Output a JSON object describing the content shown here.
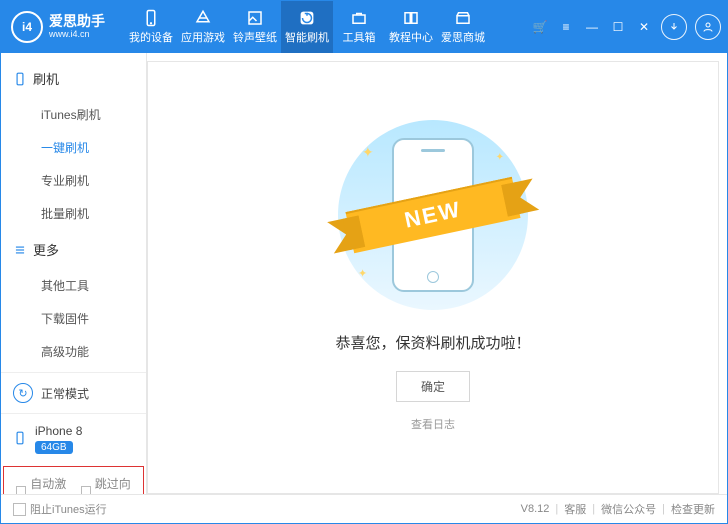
{
  "brand": {
    "name": "爱思助手",
    "site": "www.i4.cn",
    "logo_mark": "i4"
  },
  "nav": [
    {
      "id": "device",
      "label": "我的设备"
    },
    {
      "id": "apps",
      "label": "应用游戏"
    },
    {
      "id": "ring",
      "label": "铃声壁纸"
    },
    {
      "id": "flash",
      "label": "智能刷机"
    },
    {
      "id": "toolbox",
      "label": "工具箱"
    },
    {
      "id": "tutorial",
      "label": "教程中心"
    },
    {
      "id": "mall",
      "label": "爱思商城"
    }
  ],
  "sidebar": {
    "flash_header": "刷机",
    "flash": [
      {
        "label": "iTunes刷机"
      },
      {
        "label": "一键刷机",
        "selected": true
      },
      {
        "label": "专业刷机"
      },
      {
        "label": "批量刷机"
      }
    ],
    "more_header": "更多",
    "more": [
      {
        "label": "其他工具"
      },
      {
        "label": "下载固件"
      },
      {
        "label": "高级功能"
      }
    ],
    "mode": {
      "label": "正常模式"
    },
    "device": {
      "name": "iPhone 8",
      "badge": "64GB"
    },
    "red_box": {
      "auto_activate": "自动激活",
      "skip_guide": "跳过向导"
    }
  },
  "content": {
    "ribbon_text": "NEW",
    "success_msg": "恭喜您，保资料刷机成功啦！",
    "ok": "确定",
    "view_log": "查看日志"
  },
  "statusbar": {
    "stop_itunes": "阻止iTunes运行",
    "version": "V8.12",
    "support": "客服",
    "wechat": "微信公众号",
    "update": "检查更新"
  }
}
